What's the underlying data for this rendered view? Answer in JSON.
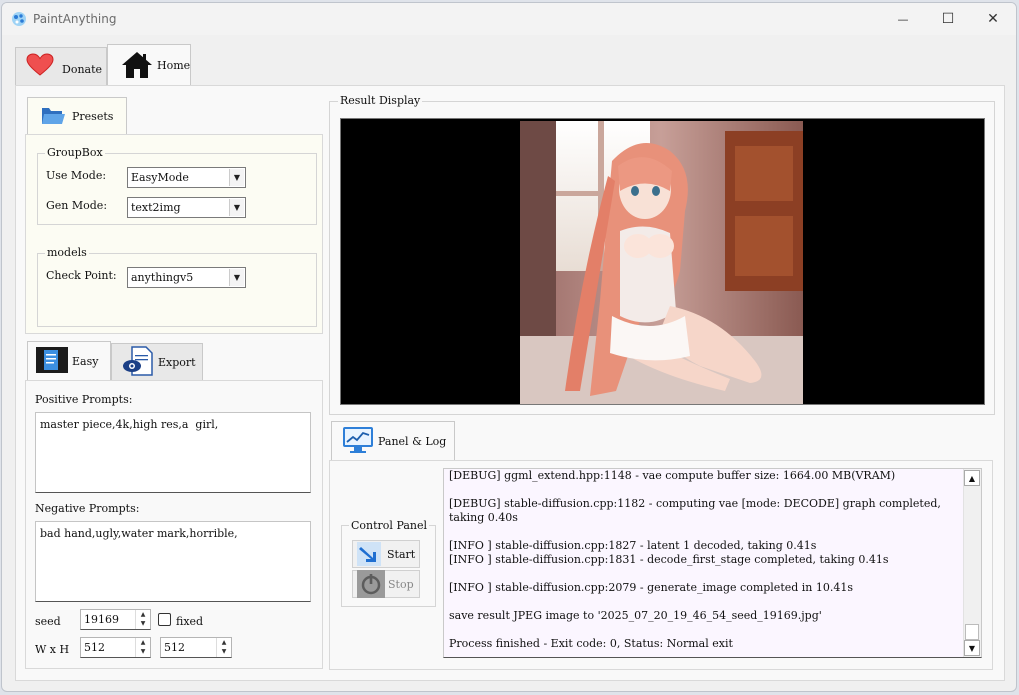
{
  "window": {
    "title": "PaintAnything",
    "minimize": "—",
    "maximize": "☐",
    "close": "✕"
  },
  "top_tabs": [
    {
      "label": "Donate",
      "icon": "heart-icon"
    },
    {
      "label": "Home",
      "icon": "home-icon"
    }
  ],
  "presets": {
    "tab_label": "Presets",
    "groupbox": {
      "title": "GroupBox",
      "use_mode_label": "Use Mode:",
      "use_mode_value": "EasyMode",
      "gen_mode_label": "Gen Mode:",
      "gen_mode_value": "text2img"
    },
    "models": {
      "title": "models",
      "checkpoint_label": "Check Point:",
      "checkpoint_value": "anythingv5"
    }
  },
  "prompt_tabs": [
    {
      "label": "Easy",
      "icon": "document-icon"
    },
    {
      "label": "Export",
      "icon": "export-icon"
    }
  ],
  "prompts": {
    "positive_label": "Positive Prompts:",
    "positive_value": "master piece,4k,high res,a  girl,",
    "negative_label": "Negative Prompts:",
    "negative_value": "bad hand,ugly,water mark,horrible,"
  },
  "params": {
    "seed_label": "seed",
    "seed_value": "19169",
    "fixed_label": "fixed",
    "fixed_checked": false,
    "wh_label": "W x H",
    "width_value": "512",
    "height_value": "512"
  },
  "result": {
    "title": "Result Display"
  },
  "panel": {
    "tab_label": "Panel & Log",
    "control_title": "Control Panel",
    "start_label": "Start",
    "stop_label": "Stop"
  },
  "log_lines": [
    "[DEBUG] ggml_extend.hpp:1148 - vae compute buffer size: 1664.00 MB(VRAM)",
    "",
    "[DEBUG] stable-diffusion.cpp:1182 - computing vae [mode: DECODE] graph completed, taking 0.40s",
    "",
    "[INFO ] stable-diffusion.cpp:1827 - latent 1 decoded, taking 0.41s",
    "[INFO ] stable-diffusion.cpp:1831 - decode_first_stage completed, taking 0.41s",
    "",
    "[INFO ] stable-diffusion.cpp:2079 - generate_image completed in 10.41s",
    "",
    "save result JPEG image to '2025_07_20_19_46_54_seed_19169.jpg'",
    "",
    "Process finished - Exit code: 0, Status: Normal exit"
  ],
  "colors": {
    "accent": "#1e6fd1",
    "log_bg": "#fbf6ff",
    "panel_bg": "#fcfcf3"
  }
}
